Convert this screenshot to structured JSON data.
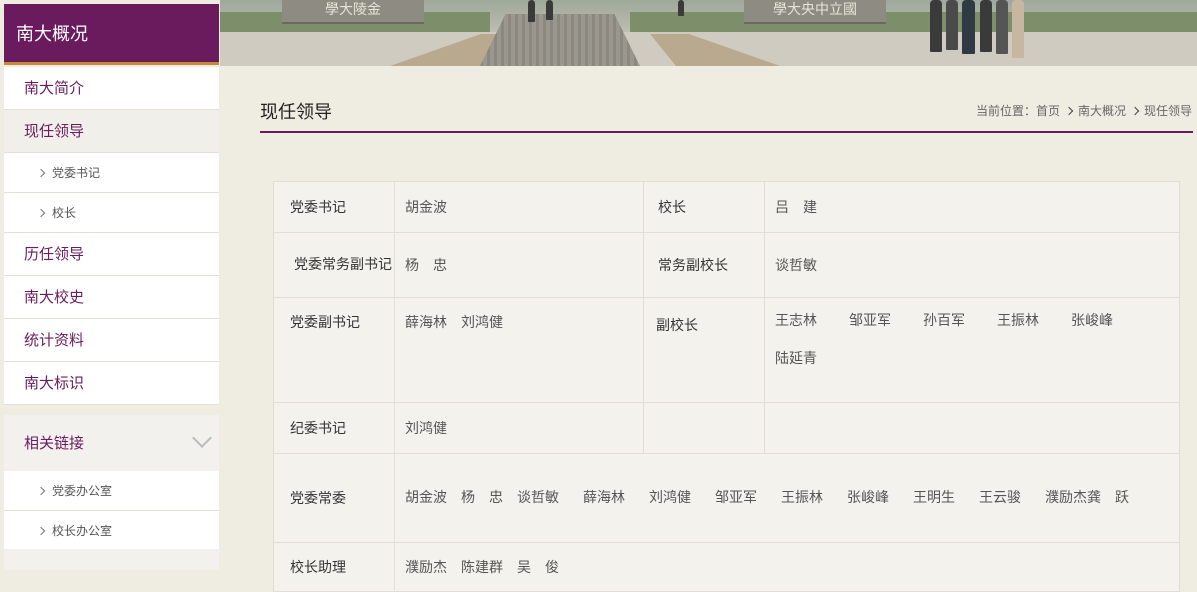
{
  "sidebar": {
    "section_title": "南大概况",
    "nav": [
      {
        "label": "南大简介",
        "type": "main"
      },
      {
        "label": "现任领导",
        "type": "main",
        "active": true
      },
      {
        "label": "党委书记",
        "type": "sub"
      },
      {
        "label": "校长",
        "type": "sub"
      },
      {
        "label": "历任领导",
        "type": "main"
      },
      {
        "label": "南大校史",
        "type": "main"
      },
      {
        "label": "统计资料",
        "type": "main"
      },
      {
        "label": "南大标识",
        "type": "main"
      }
    ],
    "related_links": {
      "title": "相关链接",
      "items": [
        "党委办公室",
        "校长办公室"
      ]
    }
  },
  "banner": {
    "stone_left": "學大陵金",
    "stone_right": "學大央中立國"
  },
  "content": {
    "page_title": "现任领导",
    "breadcrumb": {
      "prefix": "当前位置：",
      "items": [
        "首页",
        "南大概况",
        "现任领导"
      ]
    },
    "table": {
      "rows": [
        {
          "label1": "党委书记",
          "names1": [
            "胡金波"
          ],
          "label2": "校长",
          "names2": [
            "吕　建"
          ]
        },
        {
          "label1": "党委常务副书记",
          "names1": [
            "杨　忠"
          ],
          "label2": "常务副校长",
          "names2": [
            "谈哲敏"
          ]
        },
        {
          "label1": "党委副书记",
          "names1": [
            "薛海林",
            "刘鸿健"
          ],
          "label2": "副校长",
          "names2": [
            "王志林",
            "邹亚军",
            "孙百军",
            "王振林",
            "张峻峰",
            "陆延青"
          ]
        },
        {
          "label1": "纪委书记",
          "names1": [
            "刘鸿健"
          ],
          "label2": "",
          "names2": []
        },
        {
          "label1": "党委常委",
          "names": [
            "胡金波",
            "杨　忠",
            "谈哲敏",
            "薛海林",
            "刘鸿健",
            "邹亚军",
            "王振林",
            "张峻峰",
            "王明生",
            "王云骏",
            "濮励杰",
            "龚　跃"
          ]
        },
        {
          "label1": "校长助理",
          "names": [
            "濮励杰",
            "陈建群",
            "吴　俊"
          ]
        }
      ]
    }
  },
  "colors": {
    "brand": "#6a1b5e",
    "accent": "#c48a3a",
    "page_bg": "#efece2"
  }
}
